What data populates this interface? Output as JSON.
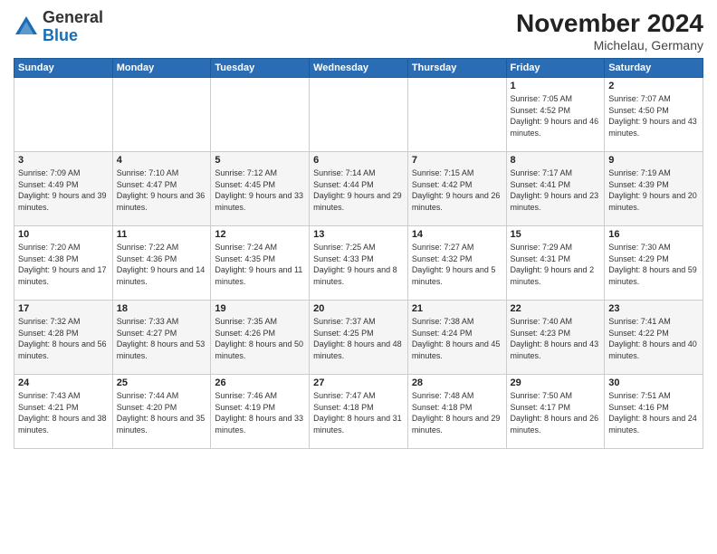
{
  "header": {
    "logo_general": "General",
    "logo_blue": "Blue",
    "month_title": "November 2024",
    "location": "Michelau, Germany"
  },
  "weekdays": [
    "Sunday",
    "Monday",
    "Tuesday",
    "Wednesday",
    "Thursday",
    "Friday",
    "Saturday"
  ],
  "weeks": [
    [
      {
        "day": "",
        "info": ""
      },
      {
        "day": "",
        "info": ""
      },
      {
        "day": "",
        "info": ""
      },
      {
        "day": "",
        "info": ""
      },
      {
        "day": "",
        "info": ""
      },
      {
        "day": "1",
        "info": "Sunrise: 7:05 AM\nSunset: 4:52 PM\nDaylight: 9 hours and 46 minutes."
      },
      {
        "day": "2",
        "info": "Sunrise: 7:07 AM\nSunset: 4:50 PM\nDaylight: 9 hours and 43 minutes."
      }
    ],
    [
      {
        "day": "3",
        "info": "Sunrise: 7:09 AM\nSunset: 4:49 PM\nDaylight: 9 hours and 39 minutes."
      },
      {
        "day": "4",
        "info": "Sunrise: 7:10 AM\nSunset: 4:47 PM\nDaylight: 9 hours and 36 minutes."
      },
      {
        "day": "5",
        "info": "Sunrise: 7:12 AM\nSunset: 4:45 PM\nDaylight: 9 hours and 33 minutes."
      },
      {
        "day": "6",
        "info": "Sunrise: 7:14 AM\nSunset: 4:44 PM\nDaylight: 9 hours and 29 minutes."
      },
      {
        "day": "7",
        "info": "Sunrise: 7:15 AM\nSunset: 4:42 PM\nDaylight: 9 hours and 26 minutes."
      },
      {
        "day": "8",
        "info": "Sunrise: 7:17 AM\nSunset: 4:41 PM\nDaylight: 9 hours and 23 minutes."
      },
      {
        "day": "9",
        "info": "Sunrise: 7:19 AM\nSunset: 4:39 PM\nDaylight: 9 hours and 20 minutes."
      }
    ],
    [
      {
        "day": "10",
        "info": "Sunrise: 7:20 AM\nSunset: 4:38 PM\nDaylight: 9 hours and 17 minutes."
      },
      {
        "day": "11",
        "info": "Sunrise: 7:22 AM\nSunset: 4:36 PM\nDaylight: 9 hours and 14 minutes."
      },
      {
        "day": "12",
        "info": "Sunrise: 7:24 AM\nSunset: 4:35 PM\nDaylight: 9 hours and 11 minutes."
      },
      {
        "day": "13",
        "info": "Sunrise: 7:25 AM\nSunset: 4:33 PM\nDaylight: 9 hours and 8 minutes."
      },
      {
        "day": "14",
        "info": "Sunrise: 7:27 AM\nSunset: 4:32 PM\nDaylight: 9 hours and 5 minutes."
      },
      {
        "day": "15",
        "info": "Sunrise: 7:29 AM\nSunset: 4:31 PM\nDaylight: 9 hours and 2 minutes."
      },
      {
        "day": "16",
        "info": "Sunrise: 7:30 AM\nSunset: 4:29 PM\nDaylight: 8 hours and 59 minutes."
      }
    ],
    [
      {
        "day": "17",
        "info": "Sunrise: 7:32 AM\nSunset: 4:28 PM\nDaylight: 8 hours and 56 minutes."
      },
      {
        "day": "18",
        "info": "Sunrise: 7:33 AM\nSunset: 4:27 PM\nDaylight: 8 hours and 53 minutes."
      },
      {
        "day": "19",
        "info": "Sunrise: 7:35 AM\nSunset: 4:26 PM\nDaylight: 8 hours and 50 minutes."
      },
      {
        "day": "20",
        "info": "Sunrise: 7:37 AM\nSunset: 4:25 PM\nDaylight: 8 hours and 48 minutes."
      },
      {
        "day": "21",
        "info": "Sunrise: 7:38 AM\nSunset: 4:24 PM\nDaylight: 8 hours and 45 minutes."
      },
      {
        "day": "22",
        "info": "Sunrise: 7:40 AM\nSunset: 4:23 PM\nDaylight: 8 hours and 43 minutes."
      },
      {
        "day": "23",
        "info": "Sunrise: 7:41 AM\nSunset: 4:22 PM\nDaylight: 8 hours and 40 minutes."
      }
    ],
    [
      {
        "day": "24",
        "info": "Sunrise: 7:43 AM\nSunset: 4:21 PM\nDaylight: 8 hours and 38 minutes."
      },
      {
        "day": "25",
        "info": "Sunrise: 7:44 AM\nSunset: 4:20 PM\nDaylight: 8 hours and 35 minutes."
      },
      {
        "day": "26",
        "info": "Sunrise: 7:46 AM\nSunset: 4:19 PM\nDaylight: 8 hours and 33 minutes."
      },
      {
        "day": "27",
        "info": "Sunrise: 7:47 AM\nSunset: 4:18 PM\nDaylight: 8 hours and 31 minutes."
      },
      {
        "day": "28",
        "info": "Sunrise: 7:48 AM\nSunset: 4:18 PM\nDaylight: 8 hours and 29 minutes."
      },
      {
        "day": "29",
        "info": "Sunrise: 7:50 AM\nSunset: 4:17 PM\nDaylight: 8 hours and 26 minutes."
      },
      {
        "day": "30",
        "info": "Sunrise: 7:51 AM\nSunset: 4:16 PM\nDaylight: 8 hours and 24 minutes."
      }
    ]
  ]
}
